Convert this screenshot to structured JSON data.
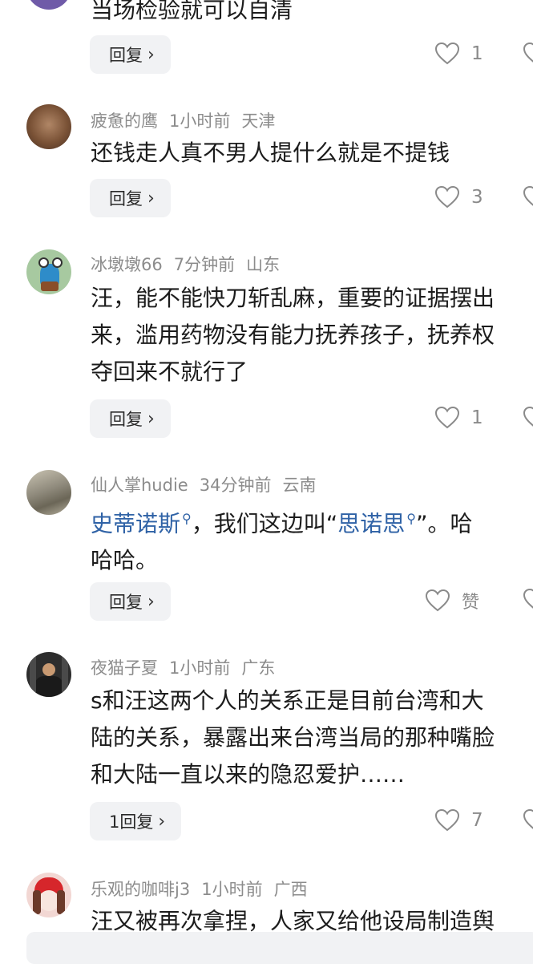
{
  "top_comment": {
    "text": "当场检验就可以自清",
    "reply_label": "回复",
    "likes": "1"
  },
  "comments": [
    {
      "username": "疲惫的鹰",
      "time": "1小时前",
      "location": "天津",
      "lines": [
        "还钱走人真不男人提什么就是不提钱"
      ],
      "reply_label": "回复",
      "likes": "3"
    },
    {
      "username": "冰墩墩66",
      "time": "7分钟前",
      "location": "山东",
      "lines": [
        "汪，能不能快刀斩乱麻，重要的证据摆出",
        "来，滥用药物没有能力抚养孩子，抚养权",
        "夺回来不就行了"
      ],
      "reply_label": "回复",
      "likes": "1"
    },
    {
      "username": "仙人掌hudie",
      "time": "34分钟前",
      "location": "云南",
      "line1_link1": "史蒂诺斯",
      "line1_mid": "，我们这边叫“",
      "line1_link2": "思诺思",
      "line1_end": "”。哈",
      "line2": "哈哈。",
      "reply_label": "回复",
      "likes": "赞"
    },
    {
      "username": "夜猫子夏",
      "time": "1小时前",
      "location": "广东",
      "lines": [
        "s和汪这两个人的关系正是目前台湾和大",
        "陆的关系，暴露出来台湾当局的那种嘴脸",
        "和大陆一直以来的隐忍爱护……"
      ],
      "reply_label": "1回复",
      "likes": "7"
    },
    {
      "username": "乐观的咖啡j3",
      "time": "1小时前",
      "location": "广西",
      "lines": [
        "汪又被再次拿捏，人家又给他设局制造舆"
      ]
    }
  ],
  "colors": {
    "link": "#2f62a6",
    "meta": "#8c8c8c",
    "button_bg": "#f1f2f4"
  }
}
